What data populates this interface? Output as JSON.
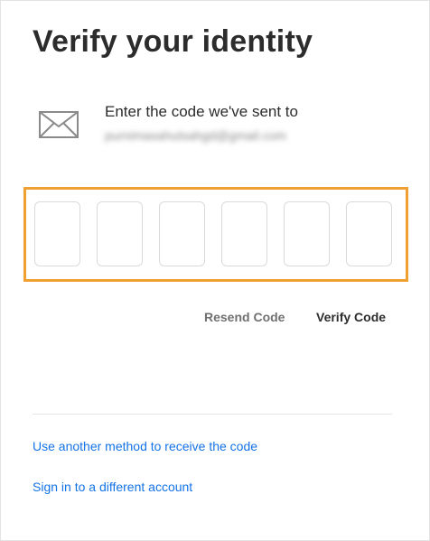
{
  "title": "Verify your identity",
  "icons": {
    "mail": "envelope-icon"
  },
  "prompt": "Enter the code we've sent to",
  "email": "purnimasahutsahgd@gmail.com",
  "code_boxes": [
    {
      "value": ""
    },
    {
      "value": ""
    },
    {
      "value": ""
    },
    {
      "value": ""
    },
    {
      "value": ""
    },
    {
      "value": ""
    }
  ],
  "actions": {
    "resend_label": "Resend Code",
    "verify_label": "Verify Code"
  },
  "links": {
    "another_method": "Use another method to receive the code",
    "different_account": "Sign in to a different account"
  },
  "colors": {
    "link": "#1473e6",
    "highlight": "#f0a030",
    "text": "#2c2c2c",
    "muted": "#707070"
  }
}
